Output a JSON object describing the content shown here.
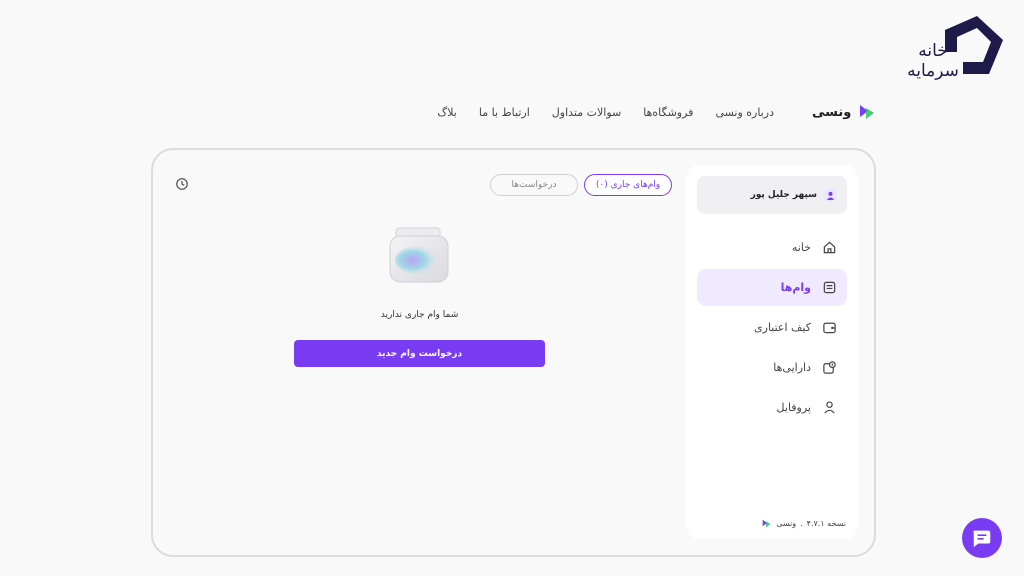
{
  "watermark": {
    "line1": "خانه",
    "line2": "سرمایه"
  },
  "header": {
    "brand": "ونسی",
    "nav": [
      "درباره ونسی",
      "فروشگاه‌ها",
      "سوالات متداول",
      "ارتباط با ما",
      "بلاگ"
    ]
  },
  "sidebar": {
    "user_name": "سپهر جلیل پور",
    "items": [
      {
        "label": "خانه",
        "icon": "home-icon"
      },
      {
        "label": "وام‌ها",
        "icon": "loan-icon"
      },
      {
        "label": "کیف اعتباری",
        "icon": "wallet-icon"
      },
      {
        "label": "دارایی‌ها",
        "icon": "assets-icon"
      },
      {
        "label": "پروفایل",
        "icon": "user-icon"
      }
    ],
    "active_index": 1,
    "footer_brand": "ونسی",
    "footer_sep": ".",
    "footer_version": "نسخه ۴.۷.۱"
  },
  "main": {
    "tab_active": "وام‌های جاری (۰)",
    "tab_requests": "درخواست‌ها",
    "empty_text": "شما وام جاری ندارید",
    "cta": "درخواست وام جدید"
  },
  "colors": {
    "accent": "#7a3cf2",
    "active_bg": "#efeaff",
    "text": "#333333"
  }
}
